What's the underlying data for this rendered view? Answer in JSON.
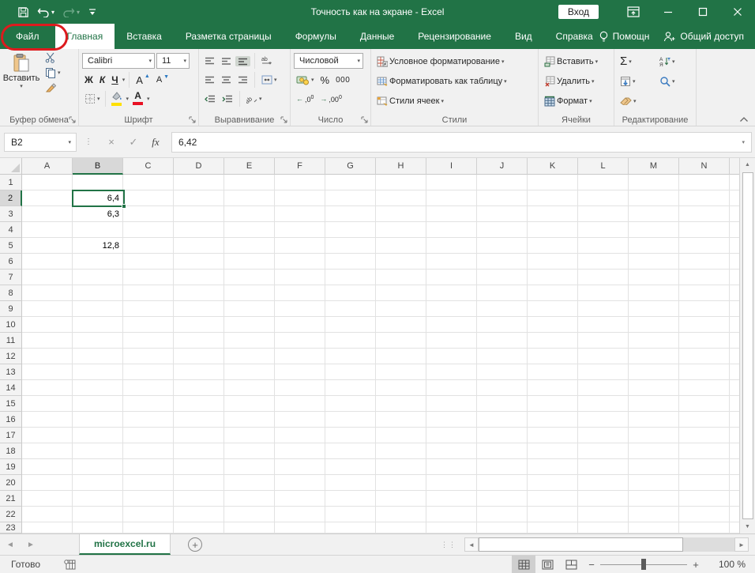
{
  "colors": {
    "accent": "#217346",
    "annotation_red": "#dd1b1e",
    "fill_yellow": "#ffe000",
    "font_red": "#e81123"
  },
  "title_bar": {
    "title": "Точность как на экране - Excel",
    "sign_in": "Вход"
  },
  "tabs": [
    {
      "name": "file",
      "label": "Файл",
      "type": "file"
    },
    {
      "name": "home",
      "label": "Главная",
      "type": "active"
    },
    {
      "name": "insert",
      "label": "Вставка",
      "type": "normal"
    },
    {
      "name": "page-layout",
      "label": "Разметка страницы",
      "type": "normal"
    },
    {
      "name": "formulas",
      "label": "Формулы",
      "type": "normal"
    },
    {
      "name": "data",
      "label": "Данные",
      "type": "normal"
    },
    {
      "name": "review",
      "label": "Рецензирование",
      "type": "normal"
    },
    {
      "name": "view",
      "label": "Вид",
      "type": "normal"
    },
    {
      "name": "help",
      "label": "Справка",
      "type": "normal"
    }
  ],
  "tab_extras": {
    "assistant": "Помощн",
    "share": "Общий доступ"
  },
  "ribbon": {
    "clipboard": {
      "paste": "Вставить",
      "label": "Буфер обмена"
    },
    "font": {
      "family": "Calibri",
      "size": "11",
      "bold": "Ж",
      "italic": "К",
      "underline": "Ч",
      "label": "Шрифт"
    },
    "alignment": {
      "label": "Выравнивание"
    },
    "number": {
      "format": "Числовой",
      "percent": "%",
      "thousands": "000",
      "inc_decimal": ",0",
      "dec_decimal": ",00",
      "label": "Число"
    },
    "styles": {
      "items": [
        "Условное форматирование",
        "Форматировать как таблицу",
        "Стили ячеек"
      ],
      "label": "Стили"
    },
    "cells": {
      "items": [
        "Вставить",
        "Удалить",
        "Формат"
      ],
      "label": "Ячейки"
    },
    "editing": {
      "sigma": "Σ",
      "sort_top": "А",
      "sort_bottom": "Я",
      "label": "Редактирование"
    }
  },
  "formula_bar": {
    "name_box": "B2",
    "fx": "fx",
    "value": "6,42"
  },
  "grid": {
    "columns": [
      "A",
      "B",
      "C",
      "D",
      "E",
      "F",
      "G",
      "H",
      "I",
      "J",
      "K",
      "L",
      "M",
      "N"
    ],
    "row_count": 23,
    "selected_cell": "B2",
    "selected_col": "B",
    "selected_row": 2,
    "cells": {
      "B2": "6,4",
      "B3": "6,3",
      "B5": "12,8"
    }
  },
  "sheet_bar": {
    "active_tab": "microexcel.ru"
  },
  "status_bar": {
    "mode": "Готово",
    "zoom": "100 %"
  }
}
